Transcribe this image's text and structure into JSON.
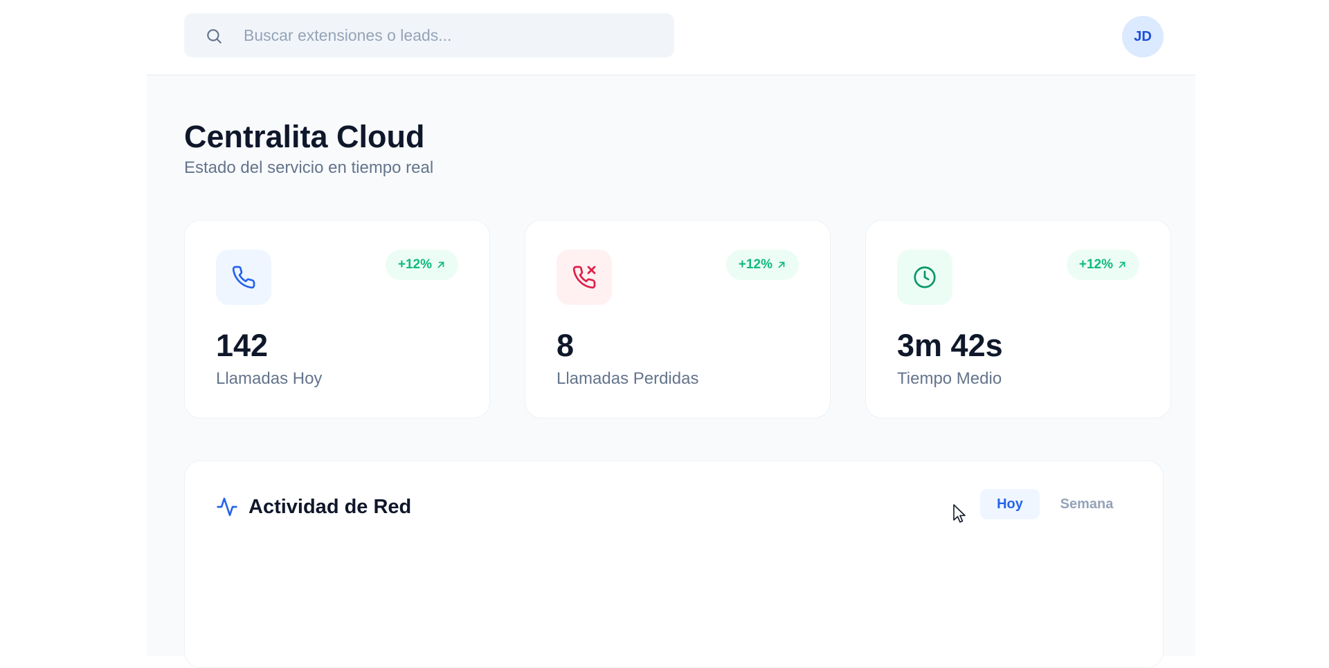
{
  "search": {
    "placeholder": "Buscar extensiones o leads...",
    "value": ""
  },
  "user": {
    "initials": "JD"
  },
  "header": {
    "title": "Centralita Cloud",
    "subtitle": "Estado del servicio en tiempo real"
  },
  "stats": [
    {
      "icon": "phone-icon",
      "accent": "#2563eb",
      "bg": "#eff6ff",
      "trend": "+12%",
      "value": "142",
      "label": "Llamadas Hoy"
    },
    {
      "icon": "phone-missed-icon",
      "accent": "#e11d48",
      "bg": "#fff1f2",
      "trend": "+12%",
      "value": "8",
      "label": "Llamadas Perdidas"
    },
    {
      "icon": "clock-icon",
      "accent": "#059669",
      "bg": "#ecfdf5",
      "trend": "+12%",
      "value": "3m 42s",
      "label": "Tiempo Medio"
    }
  ],
  "activity": {
    "icon": "activity-icon",
    "title": "Actividad de Red",
    "tabs": [
      {
        "label": "Hoy",
        "active": true
      },
      {
        "label": "Semana",
        "active": false
      }
    ]
  },
  "colors": {
    "accent": "#2563eb",
    "positive": "#10b981",
    "danger": "#e11d48"
  }
}
